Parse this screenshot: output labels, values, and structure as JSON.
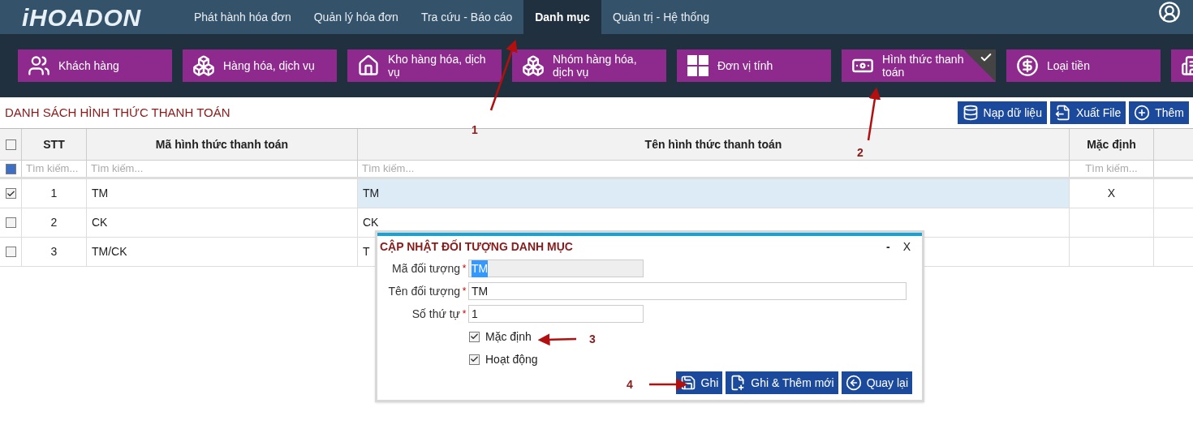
{
  "nav": {
    "logo": "iHOADON",
    "items": [
      {
        "label": "Phát hành hóa đơn",
        "selected": false
      },
      {
        "label": "Quản lý hóa đơn",
        "selected": false
      },
      {
        "label": "Tra cứu -  Báo cáo",
        "selected": false
      },
      {
        "label": "Danh mục",
        "selected": true
      },
      {
        "label": "Quản trị - Hệ thống",
        "selected": false
      }
    ]
  },
  "tiles": [
    {
      "kind": "customers",
      "label": "Khách hàng",
      "selected": false
    },
    {
      "kind": "goods",
      "label": "Hàng hóa, dịch vụ",
      "selected": false
    },
    {
      "kind": "warehouse",
      "label": "Kho hàng hóa, dịch vụ",
      "selected": false
    },
    {
      "kind": "goods",
      "label": "Nhóm hàng hóa, dịch vụ",
      "selected": false
    },
    {
      "kind": "units",
      "label": "Đơn vị tính",
      "selected": false
    },
    {
      "kind": "payment",
      "label": "Hình thức thanh toán",
      "selected": true
    },
    {
      "kind": "currency",
      "label": "Loại tiền",
      "selected": false
    },
    {
      "kind": "building"
    }
  ],
  "list_title": "DANH SÁCH HÌNH THỨC THANH TOÁN",
  "toolbar_buttons": [
    {
      "kind": "load",
      "label": "Nạp dữ liệu"
    },
    {
      "kind": "export",
      "label": "Xuất File"
    },
    {
      "kind": "add",
      "label": "Thêm"
    }
  ],
  "table": {
    "columns": [
      "STT",
      "Mã hình thức thanh toán",
      "Tên hình thức thanh toán",
      "Mặc định"
    ],
    "select_all_checked": false,
    "filter_checkbox_on": true,
    "search_placeholders": [
      "Tìm kiếm...",
      "Tìm kiếm...",
      "Tìm kiếm...",
      "Tìm kiếm..."
    ],
    "rows": [
      {
        "checked": true,
        "selected": true,
        "stt": "1",
        "code": "TM",
        "name": "TM",
        "default": "X"
      },
      {
        "checked": false,
        "selected": false,
        "stt": "2",
        "code": "CK",
        "name": "CK"
      },
      {
        "checked": false,
        "selected": false,
        "stt": "3",
        "code": "TM/CK",
        "name": "T"
      }
    ]
  },
  "dialog": {
    "title": "CẬP NHẬT ĐỐI TƯỢNG DANH MỤC",
    "minimize": "-",
    "close": "X",
    "fields": [
      {
        "label": "Mã đối tượng",
        "required": "*",
        "value": "TM",
        "kind": "short",
        "disabled": true,
        "highlighted": true
      },
      {
        "label": "Tên đối tượng",
        "required": "*",
        "value": "TM",
        "kind": "wide",
        "disabled": false,
        "highlighted": false
      },
      {
        "label": "Số thứ tự",
        "required": "*",
        "value": "1",
        "kind": "short",
        "disabled": false,
        "highlighted": false
      }
    ],
    "checkboxes": [
      {
        "label": "Mặc định",
        "checked": true
      },
      {
        "label": "Hoạt động",
        "checked": true
      }
    ],
    "buttons": [
      {
        "kind": "save",
        "label": "Ghi"
      },
      {
        "kind": "save_new",
        "label": "Ghi & Thêm mới"
      },
      {
        "kind": "back",
        "label": "Quay lại"
      }
    ]
  },
  "annotations": [
    "1",
    "2",
    "3",
    "4"
  ]
}
